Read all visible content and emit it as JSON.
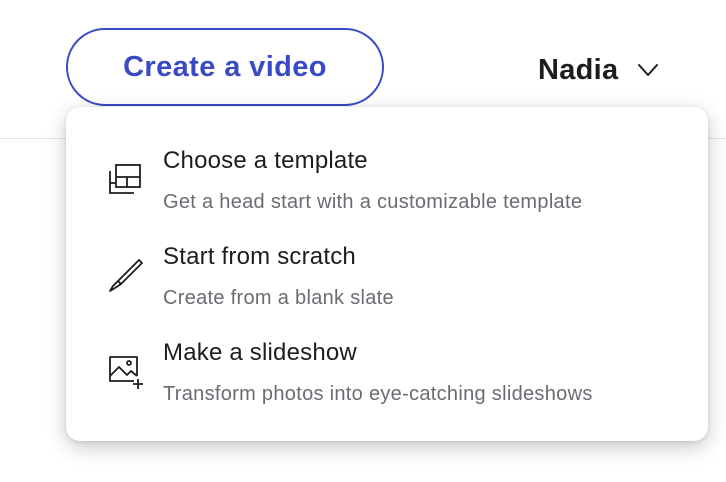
{
  "header": {
    "create_button_label": "Create a video",
    "user_name": "Nadia",
    "user_menu_icon": "chevron-down-icon"
  },
  "dropdown": {
    "items": [
      {
        "title": "Choose a template",
        "description": "Get a head start with a customizable template",
        "icon": "template-icon"
      },
      {
        "title": "Start from scratch",
        "description": "Create from a blank slate",
        "icon": "pencil-icon"
      },
      {
        "title": "Make a slideshow",
        "description": "Transform photos into eye-catching slideshows",
        "icon": "add-image-icon"
      }
    ]
  },
  "colors": {
    "accent": "#3a4ac6",
    "text_primary": "#1d1d1f",
    "text_secondary": "#6b6b73"
  }
}
